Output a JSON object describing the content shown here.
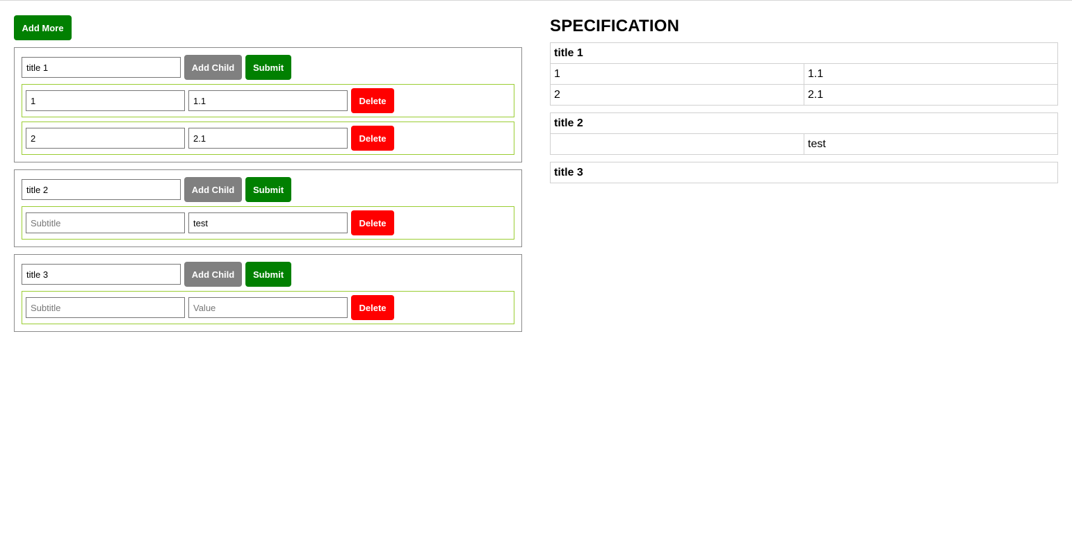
{
  "toolbar": {
    "add_more_label": "Add More"
  },
  "buttons": {
    "add_child": "Add Child",
    "submit": "Submit",
    "delete": "Delete"
  },
  "placeholders": {
    "subtitle": "Subtitle",
    "value": "Value"
  },
  "groups": [
    {
      "title": "title 1",
      "children": [
        {
          "subtitle": "1",
          "value": "1.1"
        },
        {
          "subtitle": "2",
          "value": "2.1"
        }
      ]
    },
    {
      "title": "title 2",
      "children": [
        {
          "subtitle": "",
          "value": "test"
        }
      ]
    },
    {
      "title": "title 3",
      "children": [
        {
          "subtitle": "",
          "value": ""
        }
      ]
    }
  ],
  "specification": {
    "heading": "SPECIFICATION",
    "tables": [
      {
        "title": "title 1",
        "rows": [
          {
            "subtitle": "1",
            "value": "1.1"
          },
          {
            "subtitle": "2",
            "value": "2.1"
          }
        ]
      },
      {
        "title": "title 2",
        "rows": [
          {
            "subtitle": "",
            "value": "test"
          }
        ]
      },
      {
        "title": "title 3",
        "rows": []
      }
    ]
  },
  "colors": {
    "green": "#018001",
    "gray": "#808080",
    "red": "#ff0000",
    "child_border": "#9acd32"
  }
}
